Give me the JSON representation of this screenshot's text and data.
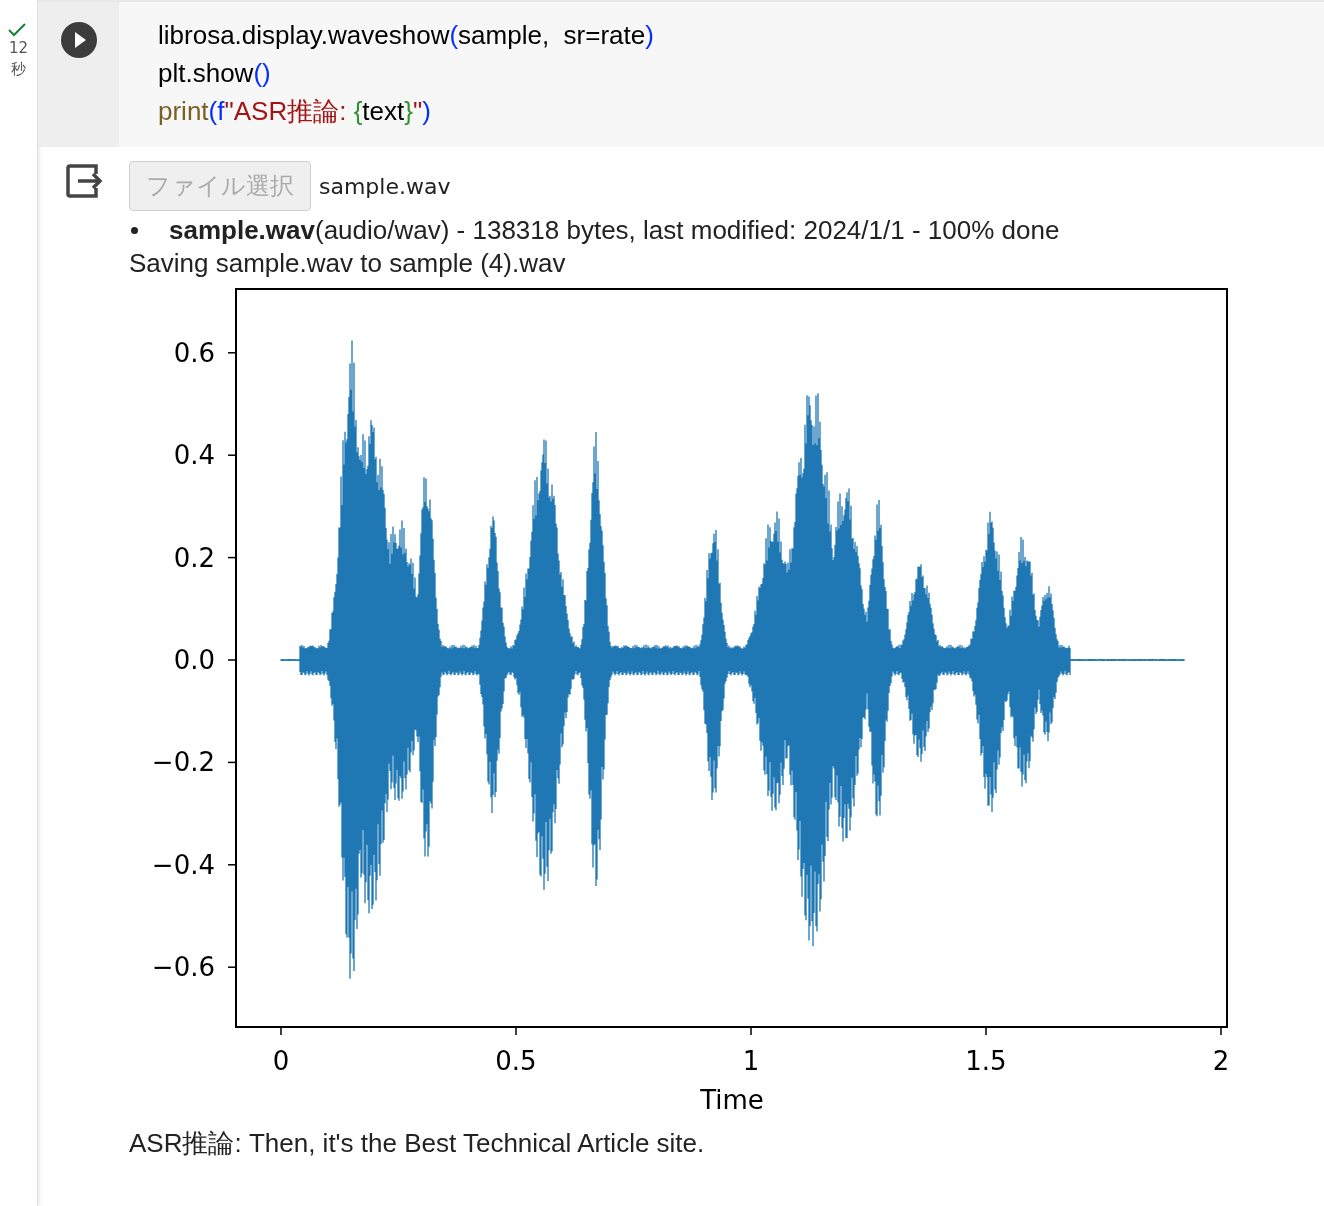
{
  "cell": {
    "status": {
      "done": true,
      "duration": "12",
      "unit": "秒"
    },
    "code_lines": [
      [
        {
          "kind": "plain",
          "text": "librosa.display.waveshow"
        },
        {
          "kind": "paren",
          "text": "("
        },
        {
          "kind": "plain",
          "text": "sample,  sr=rate"
        },
        {
          "kind": "paren",
          "text": ")"
        }
      ],
      [
        {
          "kind": "plain",
          "text": "plt.show"
        },
        {
          "kind": "paren",
          "text": "()"
        }
      ],
      [
        {
          "kind": "builtin",
          "text": "print"
        },
        {
          "kind": "paren",
          "text": "("
        },
        {
          "kind": "paren",
          "text": "f"
        },
        {
          "kind": "string",
          "text": "\"ASR推論: "
        },
        {
          "kind": "brace",
          "text": "{"
        },
        {
          "kind": "plain",
          "text": "text"
        },
        {
          "kind": "brace",
          "text": "}"
        },
        {
          "kind": "string",
          "text": "\""
        },
        {
          "kind": "paren",
          "text": ")"
        }
      ]
    ]
  },
  "output": {
    "file_button": {
      "label": "ファイル選択",
      "disabled": true
    },
    "file_name": "sample.wav",
    "upload_item": "**sample.wav**(audio/wav) - 138318 bytes, last modified: 2024/1/1 - 100% done",
    "saving_message": "Saving sample.wav to sample (4).wav",
    "plot": {
      "kind": "waveform",
      "yticks": [
        "0.6",
        "0.4",
        "0.2",
        "0.0",
        "−0.2",
        "−0.4",
        "−0.6"
      ],
      "xticks": [
        "0",
        "0.5",
        "1",
        "1.5",
        "2"
      ],
      "xlabel": "Time"
    },
    "result": "ASR推論: Then, it's the Best Technical Article site."
  }
}
